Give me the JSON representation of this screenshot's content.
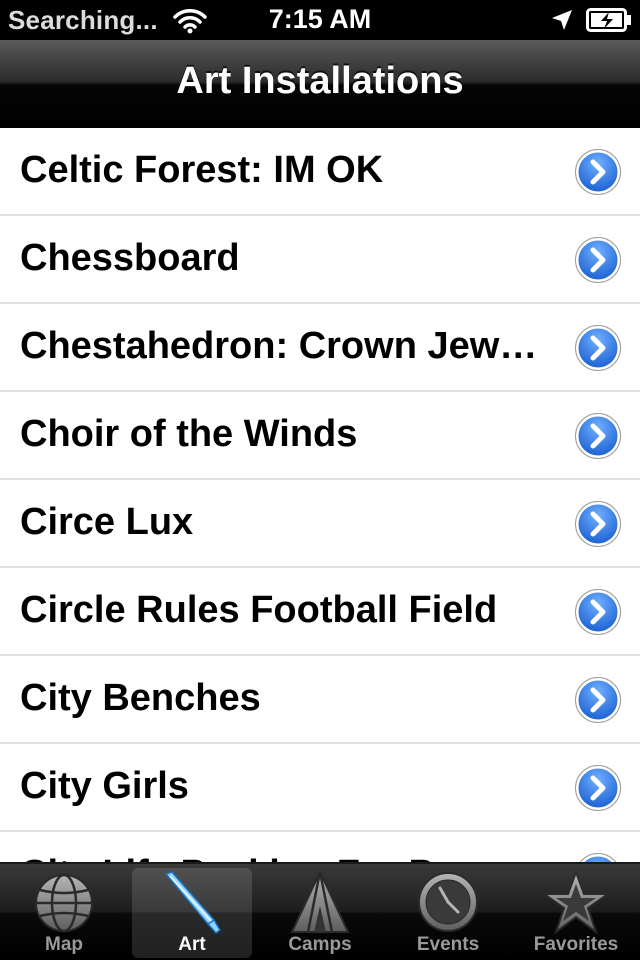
{
  "status_bar": {
    "carrier": "Searching...",
    "time": "7:15 AM"
  },
  "nav": {
    "title": "Art Installations"
  },
  "list": {
    "items": [
      "Celtic Forest:  IM OK",
      "Chessboard",
      "Chestahedron: Crown Jewel of the Heart",
      "Choir of the Winds",
      "Circe Lux",
      "Circle Rules Football Field",
      "City Benches",
      "City Girls",
      "City Life Peaking For Peace"
    ]
  },
  "tab_bar": {
    "tabs": [
      {
        "label": "Map",
        "icon": "globe-icon",
        "selected": false
      },
      {
        "label": "Art",
        "icon": "paintbrush-icon",
        "selected": true
      },
      {
        "label": "Camps",
        "icon": "tent-icon",
        "selected": false
      },
      {
        "label": "Events",
        "icon": "clock-icon",
        "selected": false
      },
      {
        "label": "Favorites",
        "icon": "star-icon",
        "selected": false
      }
    ]
  },
  "colors": {
    "disclosure_blue": "#2f7ee8",
    "selected_icon_blue": "#8fd4ff"
  }
}
